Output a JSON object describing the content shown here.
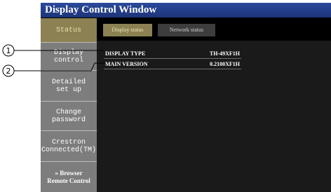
{
  "window": {
    "title": "Display Control Window"
  },
  "sidebar": {
    "items": [
      {
        "label": "Status"
      },
      {
        "label": "Display\ncontrol"
      },
      {
        "label": "Detailed\nset up"
      },
      {
        "label": "Change\npassword"
      },
      {
        "label": "Crestron\nConnected(TM)"
      },
      {
        "label": "» Browser\nRemote Control"
      }
    ],
    "active_index": 0
  },
  "tabs": [
    {
      "label": "Display status",
      "active": true
    },
    {
      "label": "Network status",
      "active": false
    }
  ],
  "status_rows": [
    {
      "label": "DISPLAY TYPE",
      "value": "TH-49XF1H"
    },
    {
      "label": "MAIN VERSION",
      "value": "0.2100XF1H"
    }
  ],
  "callouts": [
    "1",
    "2"
  ],
  "colors": {
    "titlebar": "#2a4a9c",
    "active": "#8b8152",
    "sidebar": "#7d7d7d"
  }
}
